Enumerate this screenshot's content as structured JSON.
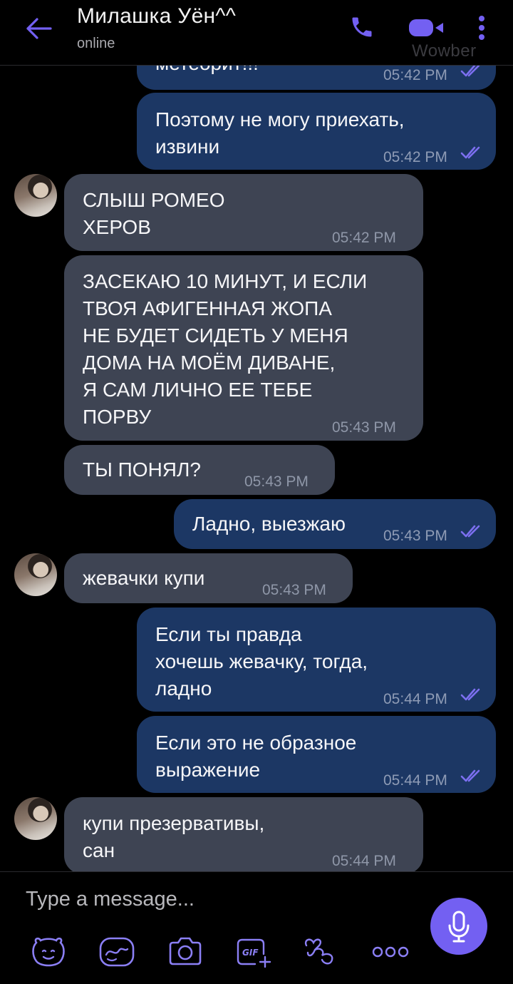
{
  "header": {
    "contact_name": "Милашка Уён^^",
    "status": "online",
    "watermark": "Wowber"
  },
  "messages": [
    {
      "dir": "out",
      "text": "метеорит!!!",
      "time": "05:42 PM",
      "read": true
    },
    {
      "dir": "out",
      "text": "Поэтому не могу приехать,\nизвини",
      "time": "05:42 PM",
      "read": true
    },
    {
      "dir": "in",
      "text": "СЛЫШ РОМЕО\nХЕРОВ",
      "time": "05:42 PM"
    },
    {
      "dir": "in",
      "text": "ЗАСЕКАЮ 10 МИНУТ, И ЕСЛИ\nТВОЯ АФИГЕННАЯ ЖОПА\nНЕ БУДЕТ СИДЕТЬ У МЕНЯ\nДОМА НА МОЁМ ДИВАНЕ,\nЯ САМ ЛИЧНО ЕЕ ТЕБЕ\nПОРВУ",
      "time": "05:43 PM"
    },
    {
      "dir": "in",
      "text": "ТЫ ПОНЯЛ?",
      "time": "05:43 PM"
    },
    {
      "dir": "out",
      "text": "Ладно, выезжаю",
      "time": "05:43 PM",
      "read": true
    },
    {
      "dir": "in",
      "text": "жевачки купи",
      "time": "05:43 PM"
    },
    {
      "dir": "out",
      "text": "Если ты правда\nхочешь жевачку, тогда,\nладно",
      "time": "05:44 PM",
      "read": true
    },
    {
      "dir": "out",
      "text": "Если это не образное\nвыражение",
      "time": "05:44 PM",
      "read": true
    },
    {
      "dir": "in",
      "text": "купи презервативы,\nсан",
      "time": "05:44 PM"
    }
  ],
  "composer": {
    "placeholder": "Type a message...",
    "tools": [
      "sticker-icon",
      "doodle-icon",
      "camera-icon",
      "gif-icon",
      "lens-icon",
      "more-icon"
    ]
  },
  "colors": {
    "outgoing_bubble": "#1c3764",
    "incoming_bubble": "#3e4453",
    "accent": "#7360f2",
    "background": "#000000"
  }
}
